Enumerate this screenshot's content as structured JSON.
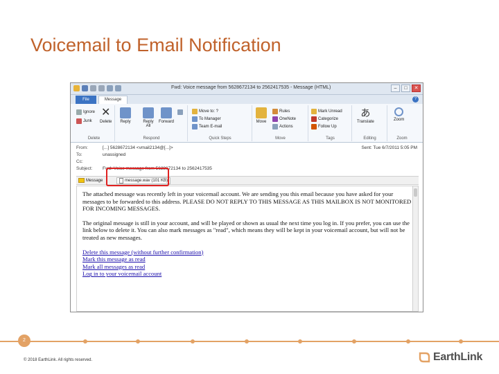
{
  "slide": {
    "title": "Voicemail to Email Notification",
    "page_number": "2",
    "footer": "© 2018 EarthLink. All rights reserved.",
    "logo_text": "EarthLink",
    "accent_color": "#e3a265",
    "title_color": "#c0622b",
    "highlight_color": "#e0201f"
  },
  "window": {
    "title": "Fwd: Voice message from 5628672134 to 2562417535 - Message (HTML)",
    "tabs": {
      "file": "File",
      "message": "Message"
    }
  },
  "ribbon": {
    "groups": {
      "delete": "Delete",
      "respond": "Respond",
      "quick_steps": "Quick Steps",
      "move": "Move",
      "tags": "Tags",
      "editing": "Editing",
      "zoom": "Zoom"
    },
    "buttons": {
      "ignore": "Ignore",
      "junk": "Junk",
      "delete": "Delete",
      "reply": "Reply",
      "reply_all": "Reply All",
      "forward": "Forward",
      "move_to": "Move to: ?",
      "to_manager": "To Manager",
      "team_email": "Team E-mail",
      "move": "Move",
      "rules": "Rules",
      "onenote": "OneNote",
      "actions": "Actions",
      "mark_unread": "Mark Unread",
      "categorize": "Categorize",
      "follow_up": "Follow Up",
      "translate": "Translate",
      "zoom": "Zoom"
    }
  },
  "header": {
    "from_label": "From:",
    "from_value": "[...] 5628672134 <vmail2134@[...]>",
    "to_label": "To:",
    "to_value": "unassigned",
    "cc_label": "Cc:",
    "cc_value": "",
    "subject_label": "Subject:",
    "subject_value": "Fwd: Voice message from 5628672134 to 2562417535",
    "sent": "Sent: Tue 6/7/2011 5:05 PM"
  },
  "attachments": {
    "message_label": "Message",
    "file_label": "message.wav (101 KB)"
  },
  "body": {
    "paragraph1": "The attached message was recently left in your voicemail account. We are sending you this email because you have asked for your messages to be forwarded to this address. PLEASE DO NOT REPLY TO THIS MESSAGE AS THIS MAILBOX IS NOT MONITORED FOR INCOMING MESSAGES.",
    "paragraph2": "The original message is still in your account, and will be played or shown as usual the next time you log in. If you prefer, you can use the link below to delete it. You can also mark messages as \"read\", which means they will be kept in your voicemail account, but will not be treated as new messages.",
    "links": [
      "Delete this message (without further confirmation)",
      "Mark this message as read",
      "Mark all messages as read",
      "Log in to your voicemail account"
    ]
  }
}
